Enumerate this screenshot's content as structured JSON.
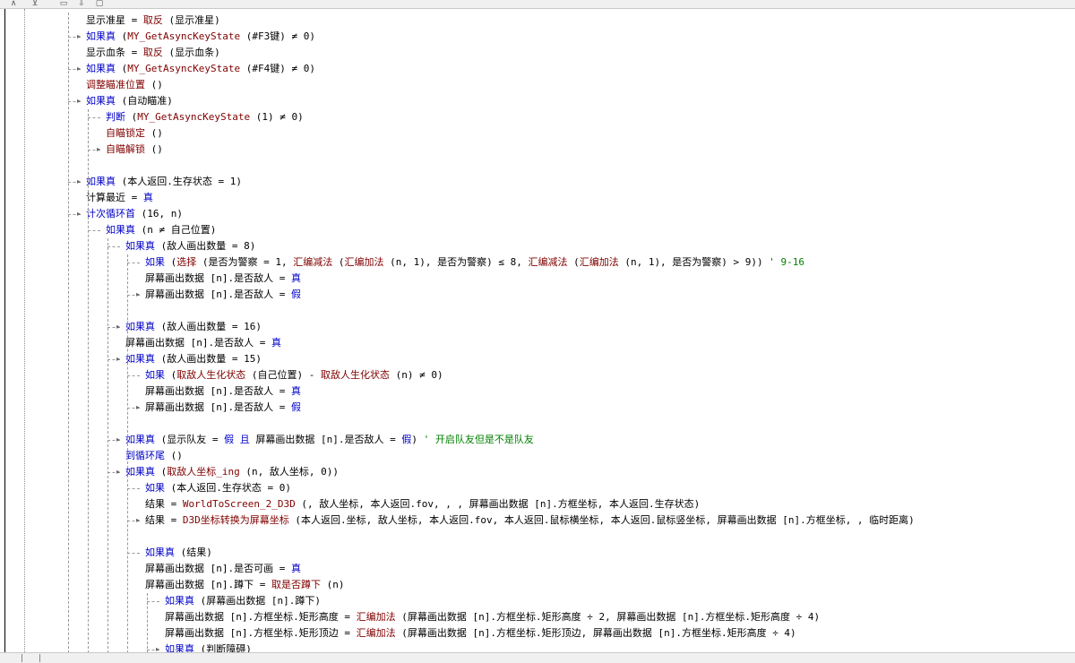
{
  "toolbar": {
    "icons": [
      "align-top-icon",
      "align-bottom-icon",
      "box-icon",
      "download-icon",
      "copy-icon"
    ]
  },
  "colors": {
    "keyword": "#0000c8",
    "function": "#800000",
    "comment": "#008000",
    "text": "#000000"
  },
  "code_lines": [
    {
      "indent": 0,
      "marker": "none",
      "tokens": [
        {
          "t": "显示准星 = ",
          "c": "tx"
        },
        {
          "t": "取反",
          "c": "fn"
        },
        {
          "t": " (显示准星)",
          "c": "tx"
        }
      ]
    },
    {
      "indent": 0,
      "marker": "arrow",
      "tokens": [
        {
          "t": "如果真",
          "c": "kw"
        },
        {
          "t": " (",
          "c": "tx"
        },
        {
          "t": "MY_GetAsyncKeyState",
          "c": "fn"
        },
        {
          "t": " (#F3键) ≠ 0)",
          "c": "tx"
        }
      ]
    },
    {
      "indent": 0,
      "marker": "none",
      "tokens": [
        {
          "t": "显示血条 = ",
          "c": "tx"
        },
        {
          "t": "取反",
          "c": "fn"
        },
        {
          "t": " (显示血条)",
          "c": "tx"
        }
      ]
    },
    {
      "indent": 0,
      "marker": "arrow",
      "tokens": [
        {
          "t": "如果真",
          "c": "kw"
        },
        {
          "t": " (",
          "c": "tx"
        },
        {
          "t": "MY_GetAsyncKeyState",
          "c": "fn"
        },
        {
          "t": " (#F4键) ≠ 0)",
          "c": "tx"
        }
      ]
    },
    {
      "indent": 0,
      "marker": "none",
      "tokens": [
        {
          "t": "调整瞄准位置",
          "c": "fn"
        },
        {
          "t": " ()",
          "c": "tx"
        }
      ]
    },
    {
      "indent": 0,
      "marker": "arrow",
      "tokens": [
        {
          "t": "如果真",
          "c": "kw"
        },
        {
          "t": " (自动瞄准)",
          "c": "tx"
        }
      ]
    },
    {
      "indent": 1,
      "marker": "branch",
      "tokens": [
        {
          "t": "判断",
          "c": "kw"
        },
        {
          "t": " (",
          "c": "tx"
        },
        {
          "t": "MY_GetAsyncKeyState",
          "c": "fn"
        },
        {
          "t": " (1) ≠ 0)",
          "c": "tx"
        }
      ]
    },
    {
      "indent": 1,
      "marker": "none",
      "tokens": [
        {
          "t": "自瞄锁定",
          "c": "fn"
        },
        {
          "t": " ()",
          "c": "tx"
        }
      ]
    },
    {
      "indent": 1,
      "marker": "arrow",
      "tokens": [
        {
          "t": "自瞄解锁",
          "c": "fn"
        },
        {
          "t": " ()",
          "c": "tx"
        }
      ]
    },
    {
      "indent": 0,
      "marker": "blank",
      "tokens": []
    },
    {
      "indent": 0,
      "marker": "arrow",
      "tokens": [
        {
          "t": "如果真",
          "c": "kw"
        },
        {
          "t": " (本人返回.生存状态 = 1)",
          "c": "tx"
        }
      ]
    },
    {
      "indent": 0,
      "marker": "none",
      "tokens": [
        {
          "t": "计算最近 = ",
          "c": "tx"
        },
        {
          "t": "真",
          "c": "kw2"
        }
      ]
    },
    {
      "indent": 0,
      "marker": "arrow",
      "tokens": [
        {
          "t": "计次循环首",
          "c": "kw"
        },
        {
          "t": " (16, n)",
          "c": "tx"
        }
      ]
    },
    {
      "indent": 1,
      "marker": "branch",
      "tokens": [
        {
          "t": "如果真",
          "c": "kw"
        },
        {
          "t": " (n ≠ 自己位置)",
          "c": "tx"
        }
      ]
    },
    {
      "indent": 2,
      "marker": "branch",
      "tokens": [
        {
          "t": "如果真",
          "c": "kw"
        },
        {
          "t": " (敌人画出数量 = 8)",
          "c": "tx"
        }
      ]
    },
    {
      "indent": 3,
      "marker": "branch",
      "tokens": [
        {
          "t": "如果",
          "c": "kw"
        },
        {
          "t": " (",
          "c": "tx"
        },
        {
          "t": "选择",
          "c": "fn"
        },
        {
          "t": " (是否为警察 = 1, ",
          "c": "tx"
        },
        {
          "t": "汇编减法",
          "c": "fn"
        },
        {
          "t": " (",
          "c": "tx"
        },
        {
          "t": "汇编加法",
          "c": "fn"
        },
        {
          "t": " (n, 1), 是否为警察) ≤ 8, ",
          "c": "tx"
        },
        {
          "t": "汇编减法",
          "c": "fn"
        },
        {
          "t": " (",
          "c": "tx"
        },
        {
          "t": "汇编加法",
          "c": "fn"
        },
        {
          "t": " (n, 1), 是否为警察) > 9)) ",
          "c": "tx"
        },
        {
          "t": "' 9-16",
          "c": "cm"
        }
      ]
    },
    {
      "indent": 3,
      "marker": "none",
      "tokens": [
        {
          "t": "屏幕画出数据 [n].是否敌人 = ",
          "c": "tx"
        },
        {
          "t": "真",
          "c": "kw2"
        }
      ]
    },
    {
      "indent": 3,
      "marker": "arrow",
      "tokens": [
        {
          "t": "屏幕画出数据 [n].是否敌人 = ",
          "c": "tx"
        },
        {
          "t": "假",
          "c": "kw2"
        }
      ]
    },
    {
      "indent": 2,
      "marker": "blank",
      "tokens": []
    },
    {
      "indent": 2,
      "marker": "arrow",
      "tokens": [
        {
          "t": "如果真",
          "c": "kw"
        },
        {
          "t": " (敌人画出数量 = 16)",
          "c": "tx"
        }
      ]
    },
    {
      "indent": 2,
      "marker": "none",
      "tokens": [
        {
          "t": "屏幕画出数据 [n].是否敌人 = ",
          "c": "tx"
        },
        {
          "t": "真",
          "c": "kw2"
        }
      ]
    },
    {
      "indent": 2,
      "marker": "arrow",
      "tokens": [
        {
          "t": "如果真",
          "c": "kw"
        },
        {
          "t": " (敌人画出数量 = 15)",
          "c": "tx"
        }
      ]
    },
    {
      "indent": 3,
      "marker": "branch",
      "tokens": [
        {
          "t": "如果",
          "c": "kw"
        },
        {
          "t": " (",
          "c": "tx"
        },
        {
          "t": "取敌人生化状态",
          "c": "fn"
        },
        {
          "t": " (自己位置) - ",
          "c": "tx"
        },
        {
          "t": "取敌人生化状态",
          "c": "fn"
        },
        {
          "t": " (n) ≠ 0)",
          "c": "tx"
        }
      ]
    },
    {
      "indent": 3,
      "marker": "none",
      "tokens": [
        {
          "t": "屏幕画出数据 [n].是否敌人 = ",
          "c": "tx"
        },
        {
          "t": "真",
          "c": "kw2"
        }
      ]
    },
    {
      "indent": 3,
      "marker": "arrow",
      "tokens": [
        {
          "t": "屏幕画出数据 [n].是否敌人 = ",
          "c": "tx"
        },
        {
          "t": "假",
          "c": "kw2"
        }
      ]
    },
    {
      "indent": 2,
      "marker": "blank",
      "tokens": []
    },
    {
      "indent": 2,
      "marker": "arrow",
      "tokens": [
        {
          "t": "如果真",
          "c": "kw"
        },
        {
          "t": " (显示队友 = ",
          "c": "tx"
        },
        {
          "t": "假",
          "c": "kw2"
        },
        {
          "t": " ",
          "c": "tx"
        },
        {
          "t": "且",
          "c": "kw"
        },
        {
          "t": " 屏幕画出数据 [n].是否敌人 = ",
          "c": "tx"
        },
        {
          "t": "假",
          "c": "kw2"
        },
        {
          "t": ") ",
          "c": "tx"
        },
        {
          "t": "' 开启队友但是不是队友",
          "c": "cm"
        }
      ]
    },
    {
      "indent": 2,
      "marker": "none",
      "tokens": [
        {
          "t": "到循环尾",
          "c": "kw"
        },
        {
          "t": " ()",
          "c": "tx"
        }
      ]
    },
    {
      "indent": 2,
      "marker": "arrow",
      "tokens": [
        {
          "t": "如果真",
          "c": "kw"
        },
        {
          "t": " (",
          "c": "tx"
        },
        {
          "t": "取敌人坐标_ing",
          "c": "fn"
        },
        {
          "t": " (n, 敌人坐标, 0))",
          "c": "tx"
        }
      ]
    },
    {
      "indent": 3,
      "marker": "branch",
      "tokens": [
        {
          "t": "如果",
          "c": "kw"
        },
        {
          "t": " (本人返回.生存状态 = 0)",
          "c": "tx"
        }
      ]
    },
    {
      "indent": 3,
      "marker": "none",
      "tokens": [
        {
          "t": "结果 = ",
          "c": "tx"
        },
        {
          "t": "WorldToScreen_2_D3D",
          "c": "fn"
        },
        {
          "t": " (, 敌人坐标, 本人返回.fov, , , 屏幕画出数据 [n].方框坐标, 本人返回.生存状态)",
          "c": "tx"
        }
      ]
    },
    {
      "indent": 3,
      "marker": "arrow",
      "tokens": [
        {
          "t": "结果 = ",
          "c": "tx"
        },
        {
          "t": "D3D坐标转换为屏幕坐标",
          "c": "fn"
        },
        {
          "t": " (本人返回.坐标, 敌人坐标, 本人返回.fov, 本人返回.鼠标横坐标, 本人返回.鼠标竖坐标, 屏幕画出数据 [n].方框坐标, , 临时距离)",
          "c": "tx"
        }
      ]
    },
    {
      "indent": 3,
      "marker": "blank",
      "tokens": []
    },
    {
      "indent": 3,
      "marker": "branch",
      "tokens": [
        {
          "t": "如果真",
          "c": "kw"
        },
        {
          "t": " (结果)",
          "c": "tx"
        }
      ]
    },
    {
      "indent": 3,
      "marker": "none",
      "tokens": [
        {
          "t": "屏幕画出数据 [n].是否可画 = ",
          "c": "tx"
        },
        {
          "t": "真",
          "c": "kw2"
        }
      ]
    },
    {
      "indent": 3,
      "marker": "none",
      "tokens": [
        {
          "t": "屏幕画出数据 [n].蹲下 = ",
          "c": "tx"
        },
        {
          "t": "取是否蹲下",
          "c": "fn"
        },
        {
          "t": " (n)",
          "c": "tx"
        }
      ]
    },
    {
      "indent": 4,
      "marker": "branch",
      "tokens": [
        {
          "t": "如果真",
          "c": "kw"
        },
        {
          "t": " (屏幕画出数据 [n].蹲下)",
          "c": "tx"
        }
      ]
    },
    {
      "indent": 4,
      "marker": "none",
      "tokens": [
        {
          "t": "屏幕画出数据 [n].方框坐标.矩形高度 = ",
          "c": "tx"
        },
        {
          "t": "汇编加法",
          "c": "fn"
        },
        {
          "t": " (屏幕画出数据 [n].方框坐标.矩形高度 ÷ 2, 屏幕画出数据 [n].方框坐标.矩形高度 ÷ 4)",
          "c": "tx"
        }
      ]
    },
    {
      "indent": 4,
      "marker": "none",
      "tokens": [
        {
          "t": "屏幕画出数据 [n].方框坐标.矩形顶边 = ",
          "c": "tx"
        },
        {
          "t": "汇编加法",
          "c": "fn"
        },
        {
          "t": " (屏幕画出数据 [n].方框坐标.矩形顶边, 屏幕画出数据 [n].方框坐标.矩形高度 ÷ 4)",
          "c": "tx"
        }
      ]
    },
    {
      "indent": 4,
      "marker": "arrow",
      "tokens": [
        {
          "t": "如果真",
          "c": "kw"
        },
        {
          "t": " (判断障碍)",
          "c": "tx"
        }
      ]
    }
  ]
}
